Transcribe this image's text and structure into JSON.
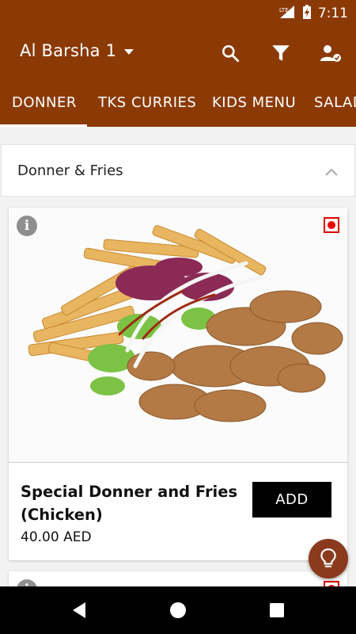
{
  "status_bar": {
    "network": "LTE",
    "time": "7:11"
  },
  "app_bar": {
    "location": "Al Barsha 1",
    "icons": [
      "search-icon",
      "filter-icon",
      "account-icon"
    ]
  },
  "tabs": [
    {
      "label": "DONNER",
      "selected": true
    },
    {
      "label": "TKS CURRIES",
      "selected": false
    },
    {
      "label": "KIDS MENU",
      "selected": false
    },
    {
      "label": "SALAD",
      "selected": false
    }
  ],
  "section": {
    "title": "Donner & Fries",
    "expanded": true
  },
  "items": [
    {
      "name": "Special Donner and Fries (Chicken)",
      "price": "40.00 AED",
      "add_label": "ADD",
      "type": "non-veg"
    }
  ],
  "colors": {
    "primary": "#8b3a05",
    "add_button": "#000000",
    "non_veg": "#dd0000",
    "fab": "#8b3a1e"
  }
}
